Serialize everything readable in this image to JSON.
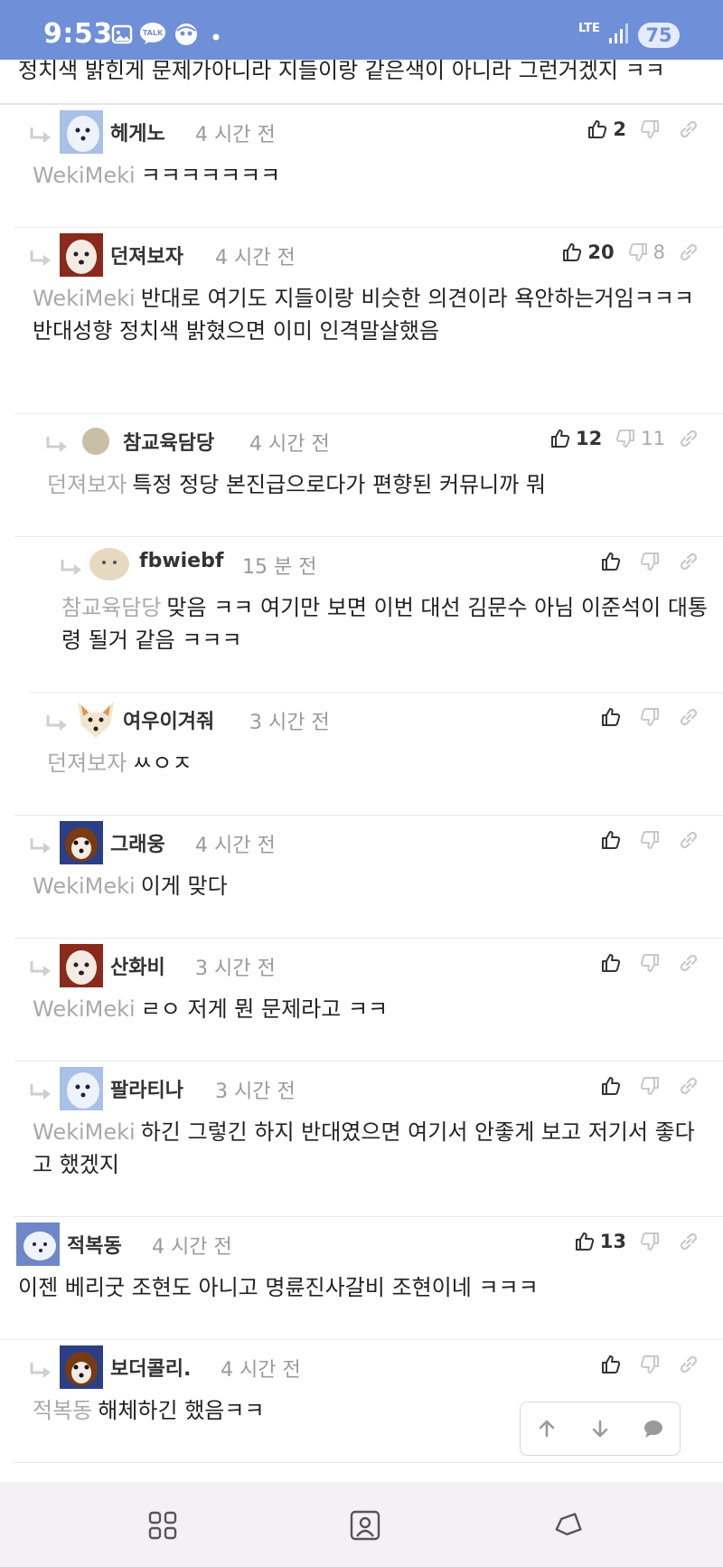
{
  "status_bar": {
    "time": "9:53",
    "network": "LTE",
    "battery": "75",
    "icons": [
      "gallery-icon",
      "talk-icon",
      "face-icon",
      "dot-icon",
      "lte-icon",
      "signal-icon",
      "battery-icon"
    ]
  },
  "top_cut_text": "정치색 밝힌게 문제가아니라 지들이랑 같은색이 아니라 그런거겠지 ㅋㅋ",
  "comments": [
    {
      "nick": "헤게노",
      "ago": "4 시간 전",
      "up": "2",
      "down": "",
      "reply_to": "WekiMeki",
      "text": "ㅋㅋㅋㅋㅋㅋㅋ"
    },
    {
      "nick": "던져보자",
      "ago": "4 시간 전",
      "up": "20",
      "down": "8",
      "reply_to": "WekiMeki",
      "text": "반대로 여기도 지들이랑 비슷한 의견이라 욕안하는거임ㅋㅋㅋ",
      "text2": "반대성향 정치색 밝혔으면 이미 인격말살했음"
    },
    {
      "nick": "참교육담당",
      "ago": "4 시간 전",
      "up": "12",
      "down": "11",
      "reply_to": "던져보자",
      "text": "특정 정당 본진급으로다가 편향된 커뮤니까 뭐"
    },
    {
      "nick": "fbwiebf",
      "ago": "15 분 전",
      "up": "",
      "down": "",
      "reply_to": "참교육담당",
      "text": "맞음 ㅋㅋ 여기만 보면 이번 대선 김문수 아님 이준석이 대통령 될거 같음 ㅋㅋㅋ"
    },
    {
      "nick": "여우이겨줘",
      "ago": "3 시간 전",
      "up": "",
      "down": "",
      "reply_to": "던져보자",
      "text": "ㅆㅇㅈ"
    },
    {
      "nick": "그래웅",
      "ago": "4 시간 전",
      "up": "",
      "down": "",
      "reply_to": "WekiMeki",
      "text": "이게 맞다"
    },
    {
      "nick": "산화비",
      "ago": "3 시간 전",
      "up": "",
      "down": "",
      "reply_to": "WekiMeki",
      "text": "ㄹㅇ 저게 뭔 문제라고 ㅋㅋ"
    },
    {
      "nick": "팔라티나",
      "ago": "3 시간 전",
      "up": "",
      "down": "",
      "reply_to": "WekiMeki",
      "text": "하긴 그렇긴 하지 반대였으면 여기서 안좋게 보고 저기서 좋다고 했겠지"
    },
    {
      "nick": "적복동",
      "ago": "4 시간 전",
      "up": "13",
      "down": "",
      "reply_to": "",
      "text": "이젠 베리굿 조현도 아니고 명륜진사갈비 조현이네 ㅋㅋㅋ"
    },
    {
      "nick": "보더콜리.",
      "ago": "4 시간 전",
      "up": "",
      "down": "",
      "reply_to": "적복동",
      "text": "해체하긴 했음ㅋㅋ"
    }
  ],
  "float_buttons": [
    "arrow-up-icon",
    "arrow-down-icon",
    "comment-icon"
  ],
  "nav_buttons": [
    "recent-apps-icon",
    "home-icon",
    "back-icon"
  ]
}
